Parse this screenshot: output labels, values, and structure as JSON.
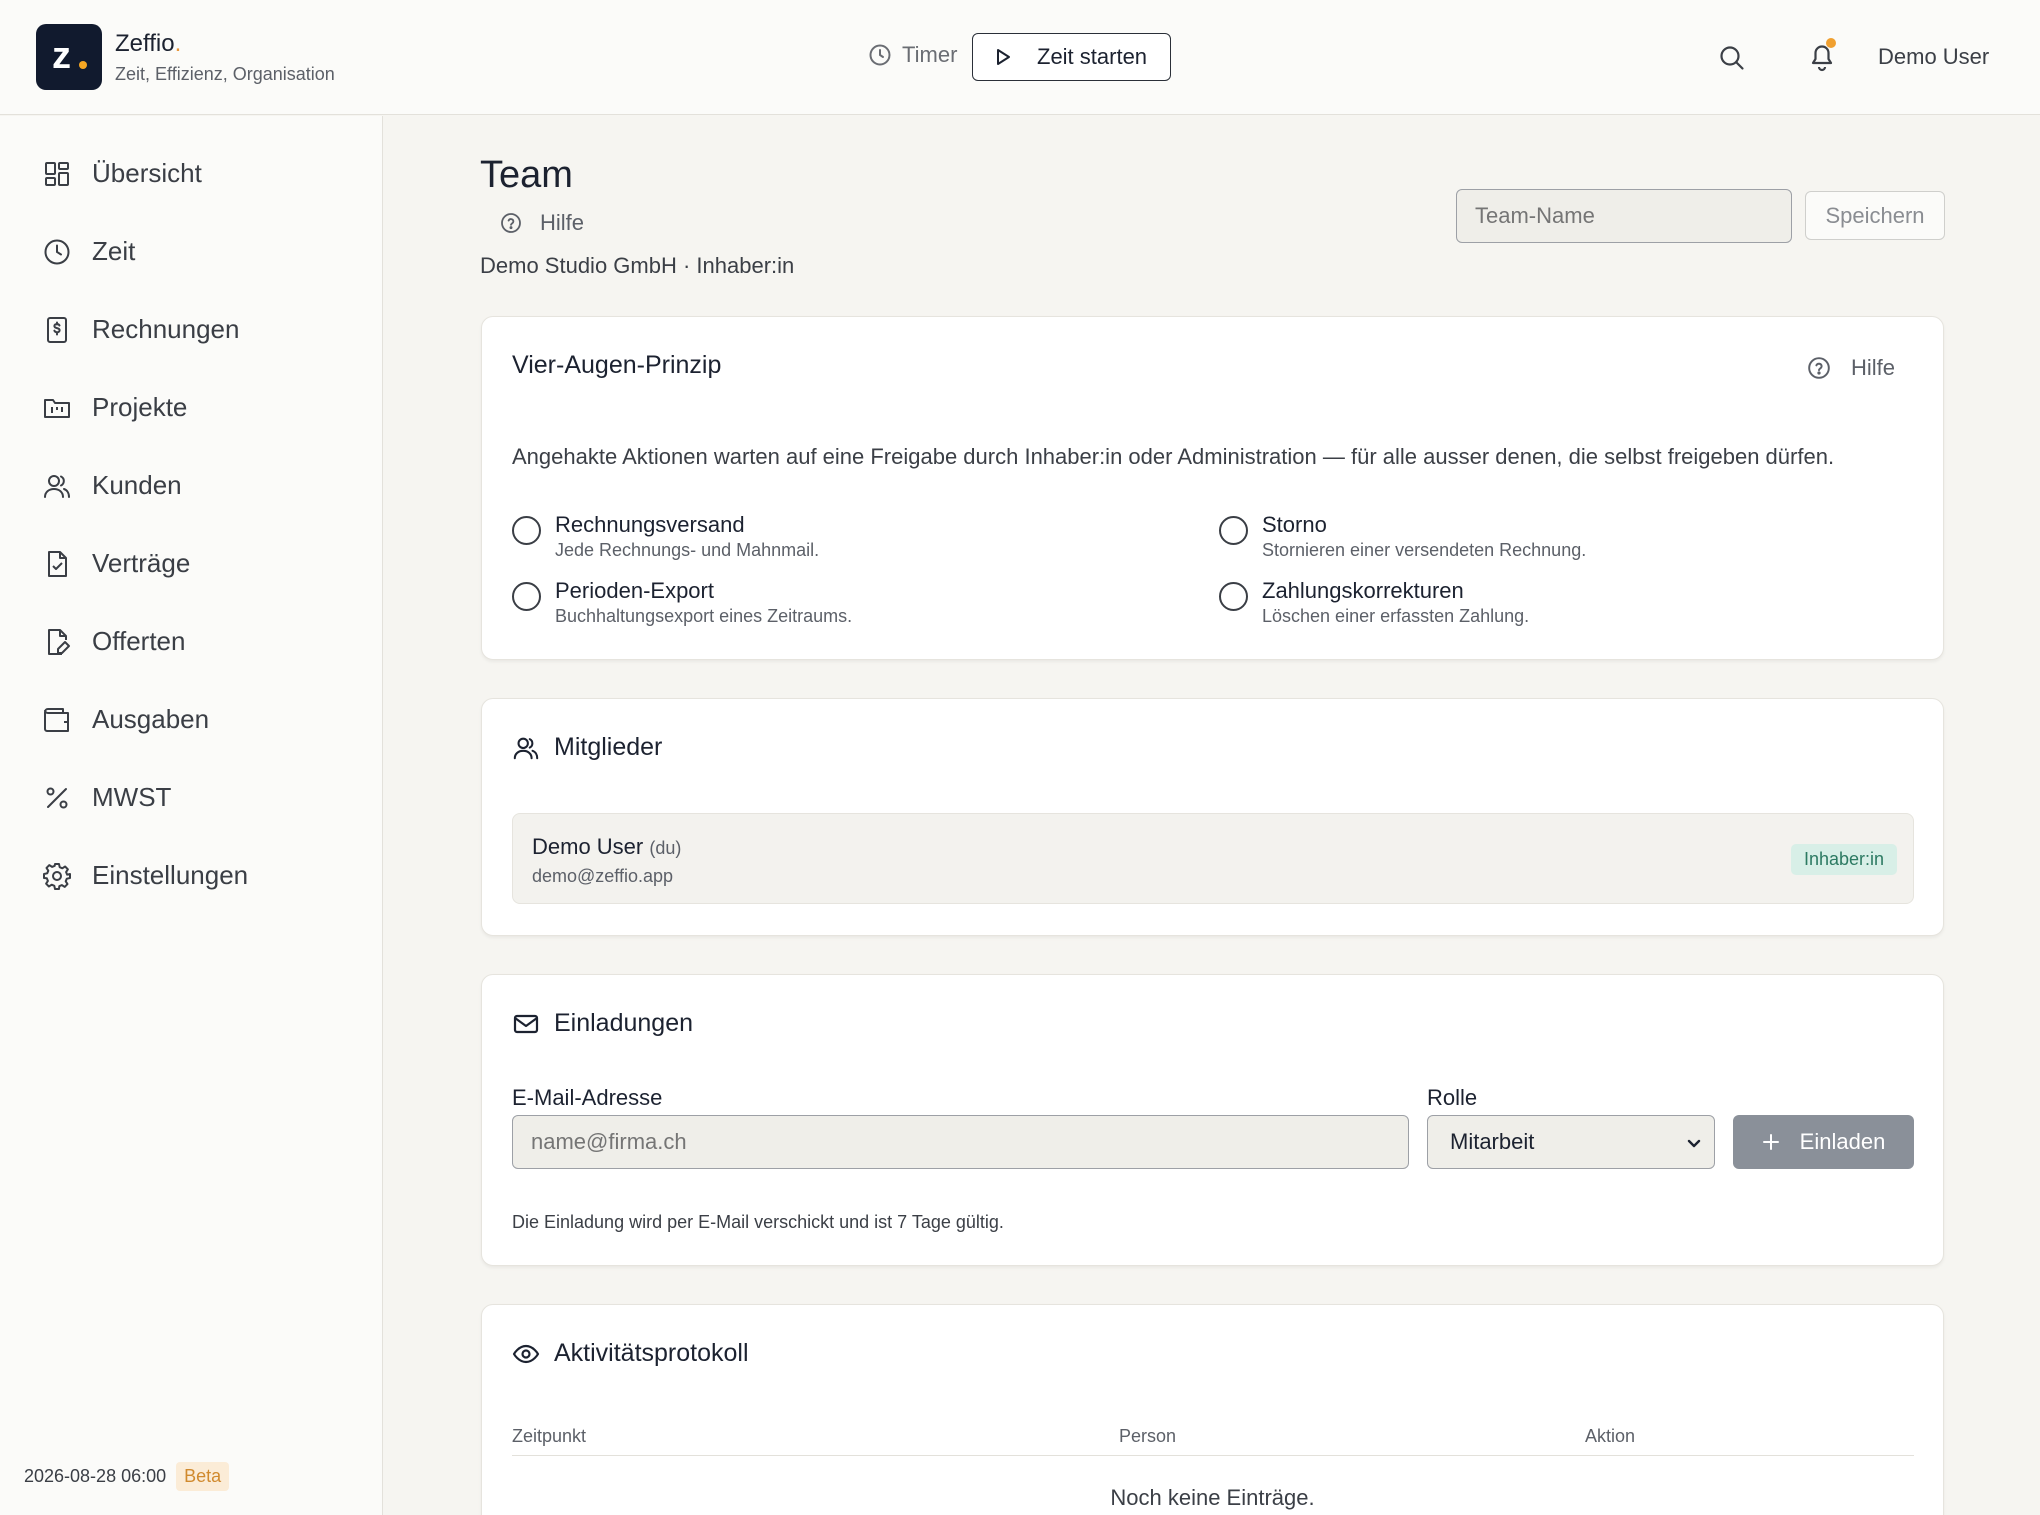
{
  "app": {
    "brand": "Zeffio",
    "tagline": "Zeit, Effizienz, Organisation"
  },
  "header": {
    "timer_label": "Timer",
    "start_label": "Zeit starten",
    "user_name": "Demo User"
  },
  "sidebar": {
    "items": [
      {
        "label": "Übersicht",
        "icon": "grid-icon"
      },
      {
        "label": "Zeit",
        "icon": "clock-icon"
      },
      {
        "label": "Rechnungen",
        "icon": "invoice-icon"
      },
      {
        "label": "Projekte",
        "icon": "folder-icon"
      },
      {
        "label": "Kunden",
        "icon": "users-icon"
      },
      {
        "label": "Verträge",
        "icon": "contract-icon"
      },
      {
        "label": "Offerten",
        "icon": "quote-icon"
      },
      {
        "label": "Ausgaben",
        "icon": "wallet-icon"
      },
      {
        "label": "MWST",
        "icon": "percent-icon"
      },
      {
        "label": "Einstellungen",
        "icon": "gear-icon"
      }
    ],
    "timestamp": "2026-08-28 06:00",
    "badge": "Beta"
  },
  "page": {
    "title": "Team",
    "help_label": "Hilfe",
    "subtitle": "Demo Studio GmbH · Inhaber:in",
    "team_name_placeholder": "Team-Name",
    "save_label": "Speichern"
  },
  "four_eyes": {
    "title": "Vier-Augen-Prinzip",
    "help_label": "Hilfe",
    "description": "Angehakte Aktionen warten auf eine Freigabe durch Inhaber:in oder Administration — für alle ausser denen, die selbst freigeben dürfen.",
    "options": [
      {
        "label": "Rechnungsversand",
        "sub": "Jede Rechnungs- und Mahnmail.",
        "checked": false
      },
      {
        "label": "Storno",
        "sub": "Stornieren einer versendeten Rechnung.",
        "checked": false
      },
      {
        "label": "Perioden-Export",
        "sub": "Buchhaltungsexport eines Zeitraums.",
        "checked": false
      },
      {
        "label": "Zahlungskorrekturen",
        "sub": "Löschen einer erfassten Zahlung.",
        "checked": false
      }
    ]
  },
  "members": {
    "title": "Mitglieder",
    "list": [
      {
        "name": "Demo User",
        "you": "(du)",
        "email": "demo@zeffio.app",
        "role": "Inhaber:in"
      }
    ]
  },
  "invitations": {
    "title": "Einladungen",
    "email_label": "E-Mail-Adresse",
    "email_placeholder": "name@firma.ch",
    "role_label": "Rolle",
    "role_value": "Mitarbeit",
    "invite_label": "Einladen",
    "hint": "Die Einladung wird per E-Mail verschickt und ist 7 Tage gültig."
  },
  "activity": {
    "title": "Aktivitätsprotokoll",
    "columns": [
      "Zeitpunkt",
      "Person",
      "Aktion"
    ],
    "empty": "Noch keine Einträge."
  },
  "colors": {
    "accent": "#111a2e",
    "brand_dot": "#f5a623",
    "role_badge_bg": "#d8efe7",
    "role_badge_text": "#2c7a62",
    "beta_bg": "#fbecd7",
    "beta_text": "#d08a2e",
    "invite_button": "#8a9099"
  }
}
